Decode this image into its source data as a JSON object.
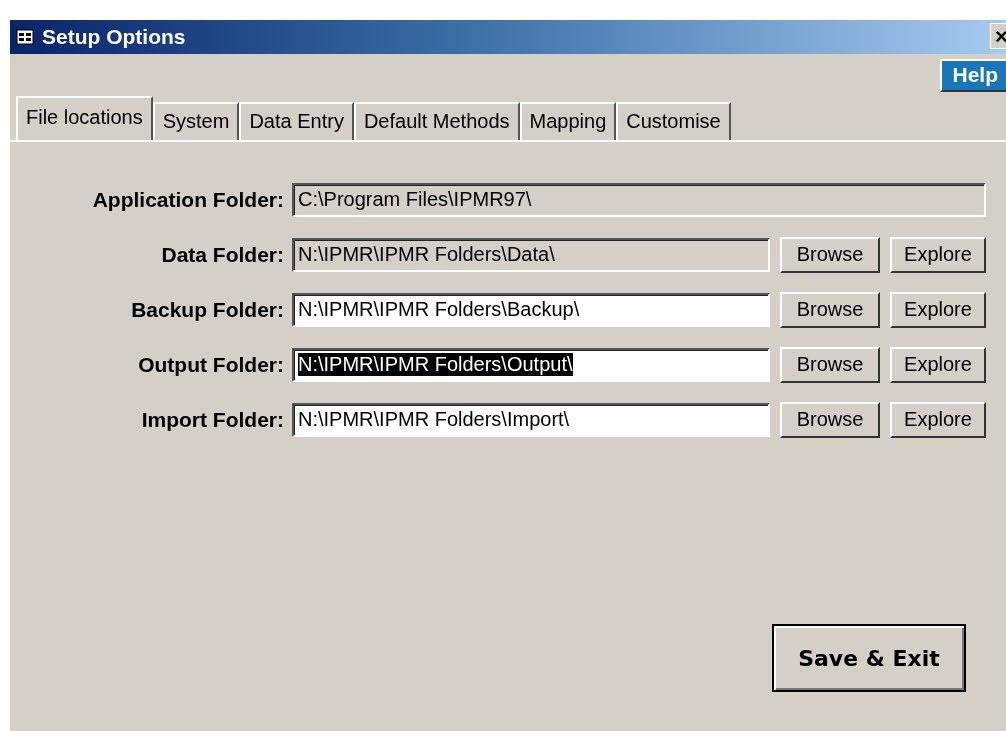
{
  "window": {
    "title": "Setup Options",
    "close": "×"
  },
  "help_button": "Help",
  "tabs": [
    {
      "label": "File locations",
      "selected": true
    },
    {
      "label": "System",
      "selected": false
    },
    {
      "label": "Data Entry",
      "selected": false
    },
    {
      "label": "Default Methods",
      "selected": false
    },
    {
      "label": "Mapping",
      "selected": false
    },
    {
      "label": "Customise",
      "selected": false
    }
  ],
  "folders": [
    {
      "label": "Application Folder:",
      "value": "C:\\Program Files\\IPMR97\\",
      "disabled": true,
      "text_selected": false
    },
    {
      "label": "Data Folder:",
      "value": "N:\\IPMR\\IPMR Folders\\Data\\",
      "disabled": true,
      "text_selected": false,
      "buttons": [
        "Browse",
        "Explore"
      ]
    },
    {
      "label": "Backup Folder:",
      "value": "N:\\IPMR\\IPMR Folders\\Backup\\",
      "disabled": false,
      "text_selected": false,
      "buttons": [
        "Browse",
        "Explore"
      ]
    },
    {
      "label": "Output Folder:",
      "value": "N:\\IPMR\\IPMR Folders\\Output\\",
      "disabled": false,
      "text_selected": true,
      "buttons": [
        "Browse",
        "Explore"
      ]
    },
    {
      "label": "Import Folder:",
      "value": "N:\\IPMR\\IPMR Folders\\Import\\",
      "disabled": false,
      "text_selected": false,
      "buttons": [
        "Browse",
        "Explore"
      ]
    }
  ],
  "save_button": "Save & Exit"
}
